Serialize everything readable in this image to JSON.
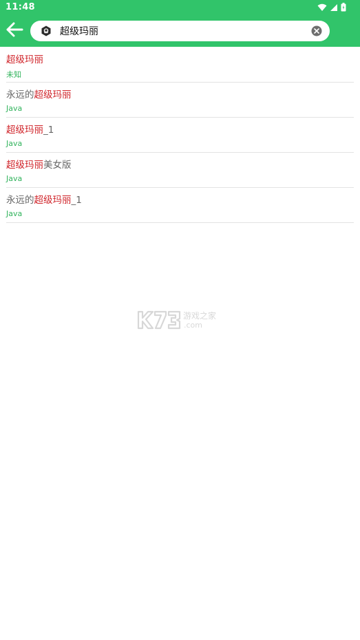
{
  "status_bar": {
    "time": "11:48",
    "icons": [
      "wifi-icon",
      "cell-signal-icon",
      "battery-icon"
    ]
  },
  "toolbar": {
    "back_icon": "arrow-left-icon",
    "search": {
      "app_icon": "app-logo-icon",
      "value": "超级玛丽",
      "placeholder": "",
      "clear_icon": "clear-circle-icon"
    }
  },
  "results": [
    {
      "prefix": "",
      "highlight": "超级玛丽",
      "suffix": "",
      "subtitle": "未知"
    },
    {
      "prefix": "永远的",
      "highlight": "超级玛丽",
      "suffix": "",
      "subtitle": "Java"
    },
    {
      "prefix": "",
      "highlight": "超级玛丽",
      "suffix": "_1",
      "subtitle": "Java"
    },
    {
      "prefix": "",
      "highlight": "超级玛丽",
      "suffix": "美女版",
      "subtitle": "Java"
    },
    {
      "prefix": "永远的",
      "highlight": "超级玛丽",
      "suffix": "_1",
      "subtitle": "Java"
    }
  ],
  "watermark": {
    "logo": "K73",
    "cn": "游戏之家",
    "domain": ".com"
  },
  "colors": {
    "accent": "#31c46a",
    "highlight": "#d0252b",
    "subtitle": "#31b35c",
    "title_text": "#666666"
  }
}
